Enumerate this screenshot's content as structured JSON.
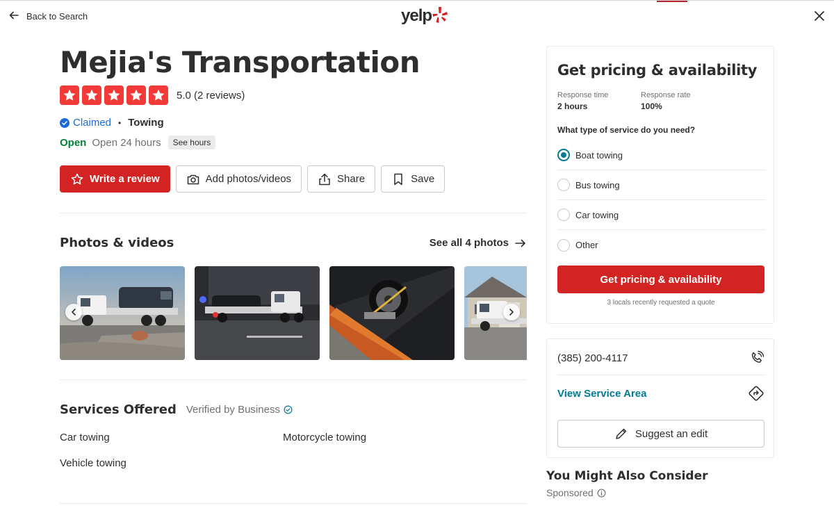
{
  "header": {
    "back_label": "Back to Search",
    "logo_text": "yelp",
    "brand_color": "#d32323"
  },
  "business": {
    "name": "Mejia's Transportation",
    "rating": 5,
    "rating_text": "5.0 (2 reviews)",
    "claimed": "Claimed",
    "separator": "•",
    "category": "Towing",
    "open_status": "Open",
    "hours": "Open 24 hours",
    "see_hours": "See hours"
  },
  "actions": {
    "write_review": "Write a review",
    "add_photos": "Add photos/videos",
    "share": "Share",
    "save": "Save"
  },
  "photos": {
    "title": "Photos & videos",
    "see_all": "See all 4 photos"
  },
  "services": {
    "title": "Services Offered",
    "verified": "Verified by Business",
    "items": [
      "Car towing",
      "Motorcycle towing",
      "Vehicle towing"
    ]
  },
  "quote": {
    "title": "Get pricing & availability",
    "response_time_label": "Response time",
    "response_time_value": "2 hours",
    "response_rate_label": "Response rate",
    "response_rate_value": "100%",
    "question": "What type of service do you need?",
    "options": [
      {
        "label": "Boat towing",
        "selected": true
      },
      {
        "label": "Bus towing",
        "selected": false
      },
      {
        "label": "Car towing",
        "selected": false
      },
      {
        "label": "Other",
        "selected": false
      }
    ],
    "cta": "Get pricing & availability",
    "locals_note": "3 locals recently requested a quote"
  },
  "contact": {
    "phone": "(385) 200-4117",
    "service_area": "View Service Area",
    "suggest_edit": "Suggest an edit"
  },
  "consider": {
    "title": "You Might Also Consider",
    "sponsored": "Sponsored"
  }
}
